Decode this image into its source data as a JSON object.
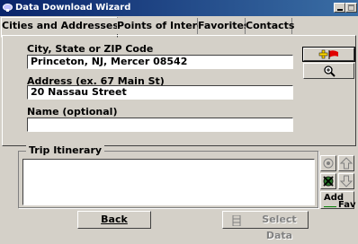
{
  "window": {
    "title": "Data Download Wizard"
  },
  "tabs": [
    {
      "label": "Cities and Addresses",
      "active": true
    },
    {
      "label": "Points of Interest",
      "active": false
    },
    {
      "label": "Favorites",
      "active": false
    },
    {
      "label": "Contacts",
      "active": false
    }
  ],
  "form": {
    "city_label": "City, State or ZIP Code",
    "city_value": "Princeton, NJ, Mercer 08542",
    "address_label": "Address (ex. 67 Main St)",
    "address_value": "20 Nassau Street",
    "name_label": "Name (optional)",
    "name_value": ""
  },
  "itinerary": {
    "label": "Trip Itinerary"
  },
  "side_buttons": {
    "add_fav_line1": "Add",
    "add_fav_line2": "Fav"
  },
  "footer": {
    "back_label": "Back",
    "select_data_label": "Select Data"
  },
  "icons": [
    "add-to-itinerary-icon",
    "zoom-in-icon",
    "gps-target-icon",
    "move-up-icon",
    "delete-icon",
    "move-down-icon",
    "select-data-icon"
  ]
}
